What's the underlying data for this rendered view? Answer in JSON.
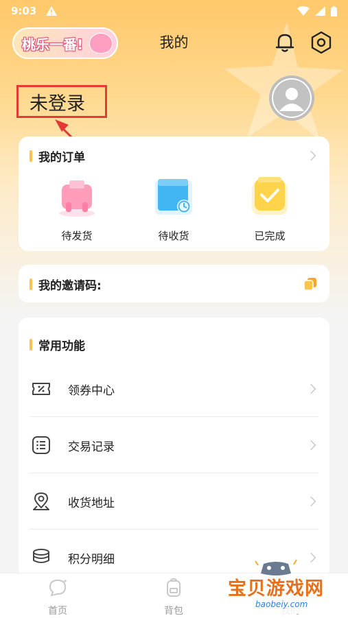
{
  "status_bar": {
    "time": "9:03",
    "alert_icon": "warning-icon",
    "wifi_icon": "wifi-icon",
    "signal_icon": "signal-icon",
    "battery_icon": "battery-icon"
  },
  "header": {
    "logo_text": "桃乐一番!",
    "title": "我的",
    "bell_icon": "bell-icon",
    "settings_icon": "settings-gear-icon"
  },
  "profile": {
    "login_label": "未登录",
    "avatar_icon": "avatar-placeholder-icon"
  },
  "orders": {
    "title": "我的订单",
    "items": [
      {
        "label": "待发货",
        "icon": "pending-shipment-icon",
        "color": "#ff8fb1"
      },
      {
        "label": "待收货",
        "icon": "pending-receipt-icon",
        "color": "#3fb1ef"
      },
      {
        "label": "已完成",
        "icon": "completed-icon",
        "color": "#ffcf40"
      }
    ]
  },
  "invite": {
    "title": "我的邀请码:",
    "copy_icon": "copy-icon"
  },
  "functions": {
    "title": "常用功能",
    "items": [
      {
        "label": "领券中心",
        "icon": "coupon-icon"
      },
      {
        "label": "交易记录",
        "icon": "transaction-list-icon"
      },
      {
        "label": "收货地址",
        "icon": "location-pin-icon"
      },
      {
        "label": "积分明细",
        "icon": "points-coins-icon"
      }
    ]
  },
  "bottom_nav": {
    "items": [
      {
        "label": "首页",
        "icon": "home-chat-icon"
      },
      {
        "label": "背包",
        "icon": "backpack-icon"
      },
      {
        "label": "我的",
        "icon": "profile-icon"
      }
    ]
  },
  "watermark": {
    "text": "宝贝游戏网",
    "sub": "baobeiy.com"
  },
  "colors": {
    "accent": "#fcc44c",
    "annotation": "#e53935",
    "header_bg": "#ffc86a"
  }
}
